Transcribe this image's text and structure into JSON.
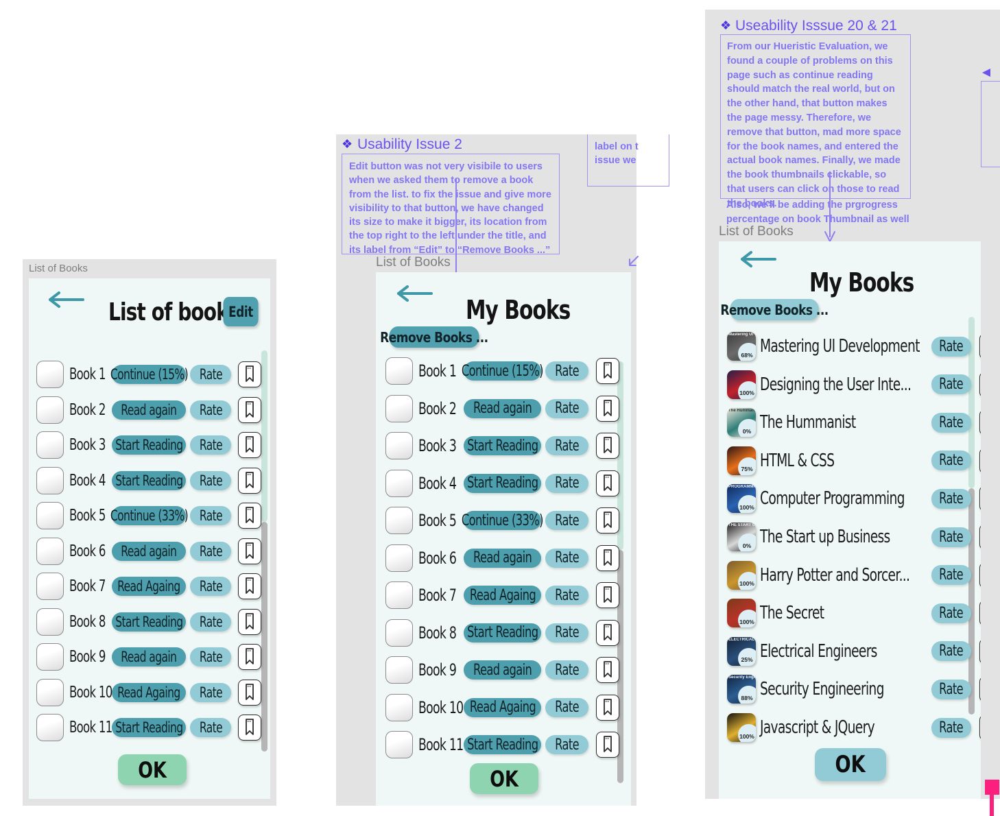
{
  "colors": {
    "artboard_bg": "#e3e3e3",
    "screen_bg": "#eff8f6",
    "primary_teal": "#4d9fad",
    "light_teal": "#92cbd6",
    "edit_teal": "#51a0b0",
    "ok_green": "#8fd4b0",
    "annotation_purple": "#8377f2",
    "annotation_title_purple": "#6a52ef",
    "pin_pink": "#fc1f7e",
    "arrow_teal": "#3d98a8"
  },
  "panel1": {
    "artboard_label": "List of Books",
    "back_icon": "back-arrow-icon",
    "title": "List of book",
    "edit_label": "Edit",
    "ok_label": "OK",
    "rows": [
      {
        "name": "Book 1",
        "action": "Continue (15%)",
        "rate": "Rate",
        "bookmark": "bookmark-icon"
      },
      {
        "name": "Book 2",
        "action": "Read again",
        "rate": "Rate",
        "bookmark": "bookmark-icon"
      },
      {
        "name": "Book 3",
        "action": "Start Reading",
        "rate": "Rate",
        "bookmark": "bookmark-icon"
      },
      {
        "name": "Book 4",
        "action": "Start Reading",
        "rate": "Rate",
        "bookmark": "bookmark-icon"
      },
      {
        "name": "Book 5",
        "action": "Continue (33%)",
        "rate": "Rate",
        "bookmark": "bookmark-icon"
      },
      {
        "name": "Book 6",
        "action": "Read again",
        "rate": "Rate",
        "bookmark": "bookmark-icon"
      },
      {
        "name": "Book 7",
        "action": "Read Againg",
        "rate": "Rate",
        "bookmark": "bookmark-icon"
      },
      {
        "name": "Book 8",
        "action": "Start Reading",
        "rate": "Rate",
        "bookmark": "bookmark-icon"
      },
      {
        "name": "Book 9",
        "action": "Read again",
        "rate": "Rate",
        "bookmark": "bookmark-icon"
      },
      {
        "name": "Book 10",
        "action": "Read Againg",
        "rate": "Rate",
        "bookmark": "bookmark-icon"
      },
      {
        "name": "Book 11",
        "action": "Start Reading",
        "rate": "Rate",
        "bookmark": "bookmark-icon"
      }
    ]
  },
  "panel2": {
    "artboard_label": "List of Books",
    "back_icon": "back-arrow-icon",
    "title": "My Books",
    "remove_label": "Remove Books ...",
    "ok_label": "OK",
    "annotation": {
      "title": "Usability Issue 2",
      "body": "Edit button was not very visibile to users when we asked them to remove a book from the list. to fix the issue and give more visibility to that button, we have changed its size to make it bigger, its location from the top right to the left under the title, and its label from “Edit” to “Remove Books ...”"
    },
    "partial_annotation": {
      "line1": "label on t",
      "line2": "issue we"
    },
    "rows": [
      {
        "name": "Book 1",
        "action": "Continue (15%)",
        "rate": "Rate",
        "bookmark": "bookmark-icon"
      },
      {
        "name": "Book 2",
        "action": "Read again",
        "rate": "Rate",
        "bookmark": "bookmark-icon"
      },
      {
        "name": "Book 3",
        "action": "Start Reading",
        "rate": "Rate",
        "bookmark": "bookmark-icon"
      },
      {
        "name": "Book 4",
        "action": "Start Reading",
        "rate": "Rate",
        "bookmark": "bookmark-icon"
      },
      {
        "name": "Book 5",
        "action": "Continue (33%)",
        "rate": "Rate",
        "bookmark": "bookmark-icon"
      },
      {
        "name": "Book 6",
        "action": "Read again",
        "rate": "Rate",
        "bookmark": "bookmark-icon"
      },
      {
        "name": "Book 7",
        "action": "Read Againg",
        "rate": "Rate",
        "bookmark": "bookmark-icon"
      },
      {
        "name": "Book 8",
        "action": "Start Reading",
        "rate": "Rate",
        "bookmark": "bookmark-icon"
      },
      {
        "name": "Book 9",
        "action": "Read again",
        "rate": "Rate",
        "bookmark": "bookmark-icon"
      },
      {
        "name": "Book 10",
        "action": "Read Againg",
        "rate": "Rate",
        "bookmark": "bookmark-icon"
      },
      {
        "name": "Book 11",
        "action": "Start Reading",
        "rate": "Rate",
        "bookmark": "bookmark-icon"
      }
    ]
  },
  "panel3": {
    "artboard_label": "List of Books",
    "back_icon": "back-arrow-icon",
    "title": "My Books",
    "remove_label": "Remove Books ...",
    "ok_label": "OK",
    "annotation": {
      "title": "Useability Isssue 20 & 21",
      "body": "From our Hueristic Evaluation, we found a couple of problems on this page such as continue reading should match the real world, but on the other hand, that button makes the page messy. Therefore, we remove that button, mad more space for the book names, and entered the actual book names. Finally, we made the book thumbnails clickable, so that users can click on those to read the books.",
      "overflow": "Also, we’ll be adding the prgrogress percentage on book Thumbnail as well"
    },
    "rows": [
      {
        "name": "Mastering UI Development",
        "progress": "68%",
        "rate": "Rate",
        "bookmark": "bookmark-icon",
        "thumb": {
          "bg": "#3b3b3b",
          "accent": "#6b6b6b",
          "caption": "Mastering UI Development with UI..."
        }
      },
      {
        "name": "Designing the User Inte...",
        "progress": "100%",
        "rate": "Rate",
        "bookmark": "bookmark-icon",
        "thumb": {
          "bg": "#241f4a",
          "accent": "#c2222a",
          "caption": ""
        }
      },
      {
        "name": "The Hummanist",
        "progress": "0%",
        "rate": "Rate",
        "bookmark": "bookmark-icon",
        "thumb": {
          "bg": "#efe7dc",
          "accent": "#2e7d77",
          "caption": "The Hummanist"
        }
      },
      {
        "name": "HTML & CSS",
        "progress": "75%",
        "rate": "Rate",
        "bookmark": "bookmark-icon",
        "thumb": {
          "bg": "#2b1416",
          "accent": "#e8701a",
          "caption": ""
        }
      },
      {
        "name": "Computer Programming",
        "progress": "100%",
        "rate": "Rate",
        "bookmark": "bookmark-icon",
        "thumb": {
          "bg": "#10275a",
          "accent": "#2a63b0",
          "caption": "PROGRAMMING"
        }
      },
      {
        "name": "The Start up Business",
        "progress": "0%",
        "rate": "Rate",
        "bookmark": "bookmark-icon",
        "thumb": {
          "bg": "#1a1a1a",
          "accent": "#d8d8d8",
          "caption": "THE START UP BUSIN..."
        }
      },
      {
        "name": "Harry Potter and Sorcer...",
        "progress": "100%",
        "rate": "Rate",
        "bookmark": "bookmark-icon",
        "thumb": {
          "bg": "#7a5a2e",
          "accent": "#c9972f",
          "caption": ""
        }
      },
      {
        "name": "The Secret",
        "progress": "100%",
        "rate": "Rate",
        "bookmark": "bookmark-icon",
        "thumb": {
          "bg": "#7a3c18",
          "accent": "#b9322a",
          "caption": ""
        }
      },
      {
        "name": "Electrical Engineers",
        "progress": "25%",
        "rate": "Rate",
        "bookmark": "bookmark-icon",
        "thumb": {
          "bg": "#122034",
          "accent": "#2a4f7a",
          "caption": "ELECTRICAL ENGINEERS"
        }
      },
      {
        "name": "Security Engineering",
        "progress": "88%",
        "rate": "Rate",
        "bookmark": "bookmark-icon",
        "thumb": {
          "bg": "#0f2340",
          "accent": "#2c5d92",
          "caption": "Security Engineering"
        }
      },
      {
        "name": "Javascript & JQuery",
        "progress": "100%",
        "rate": "Rate",
        "bookmark": "bookmark-icon",
        "thumb": {
          "bg": "#101010",
          "accent": "#e0b030",
          "caption": ""
        }
      }
    ]
  },
  "right_edge": {
    "partial_annotation": "partial-annotation-box",
    "pin": "pink-pin-marker"
  }
}
